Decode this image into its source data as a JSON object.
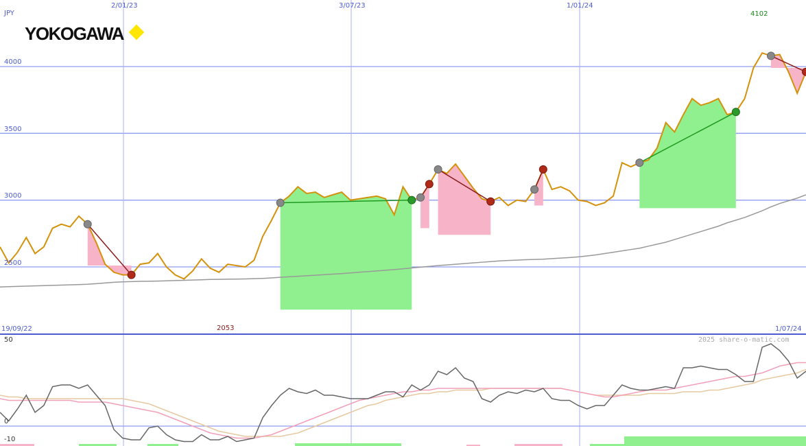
{
  "header": {
    "currency": "JPY",
    "logo_text": "YOKOGAWA",
    "logo_accent_color": "#ffe600"
  },
  "date_labels": {
    "top": [
      "2/01/23",
      "3/07/23",
      "1/01/24"
    ],
    "start": "19/09/22",
    "end": "1/07/24"
  },
  "annotations": {
    "high": "4102",
    "low": "2053"
  },
  "watermark": "2025 share-o-matic.com",
  "chart_data": [
    {
      "type": "line",
      "x_range": [
        "19/09/22",
        "1/07/24"
      ],
      "ylim": [
        2000,
        4200
      ],
      "y_ticks": [
        2500,
        3000,
        3500,
        4000
      ],
      "grid": true,
      "series": [
        {
          "name": "",
          "color": "#d4920b",
          "values": [
            2650,
            2530,
            2610,
            2720,
            2600,
            2650,
            2790,
            2820,
            2800,
            2880,
            2820,
            2680,
            2520,
            2460,
            2440,
            2440,
            2520,
            2530,
            2600,
            2500,
            2440,
            2410,
            2470,
            2560,
            2490,
            2460,
            2520,
            2510,
            2500,
            2550,
            2730,
            2850,
            2980,
            3030,
            3100,
            3050,
            3060,
            3020,
            3040,
            3060,
            3000,
            3010,
            3020,
            3030,
            3010,
            2890,
            3100,
            3000,
            3020,
            3120,
            3230,
            3200,
            3270,
            3180,
            3090,
            3010,
            2990,
            3020,
            2960,
            3000,
            2990,
            3080,
            3230,
            3080,
            3100,
            3070,
            3000,
            2990,
            2960,
            2980,
            3030,
            3280,
            3250,
            3280,
            3300,
            3390,
            3580,
            3510,
            3640,
            3760,
            3710,
            3730,
            3760,
            3640,
            3660,
            3760,
            3990,
            4102,
            4080,
            4090,
            3960,
            3800,
            3960
          ]
        },
        {
          "name": "",
          "color": "#999999",
          "values": [
            2350,
            2352,
            2354,
            2356,
            2358,
            2360,
            2362,
            2364,
            2366,
            2368,
            2370,
            2375,
            2380,
            2385,
            2388,
            2390,
            2392,
            2393,
            2394,
            2396,
            2398,
            2400,
            2402,
            2404,
            2406,
            2407,
            2408,
            2409,
            2410,
            2412,
            2414,
            2418,
            2422,
            2426,
            2430,
            2434,
            2438,
            2442,
            2446,
            2450,
            2455,
            2460,
            2465,
            2470,
            2475,
            2480,
            2486,
            2492,
            2498,
            2504,
            2510,
            2515,
            2520,
            2525,
            2530,
            2535,
            2540,
            2545,
            2548,
            2551,
            2554,
            2556,
            2558,
            2562,
            2566,
            2570,
            2575,
            2582,
            2590,
            2600,
            2610,
            2620,
            2630,
            2640,
            2655,
            2670,
            2685,
            2705,
            2725,
            2745,
            2765,
            2785,
            2805,
            2830,
            2850,
            2870,
            2895,
            2920,
            2950,
            2975,
            2995,
            3015,
            3040
          ]
        }
      ],
      "trades": [
        {
          "entry_index": 10,
          "exit_index": 15,
          "entry_value": 2510,
          "exit_value": 2410,
          "result": "loss"
        },
        {
          "entry_index": 32,
          "exit_index": 47,
          "entry_value": 2180,
          "exit_value": 2600,
          "result": "gain"
        },
        {
          "entry_index": 48,
          "exit_index": 49,
          "entry_value": 2790,
          "exit_value": 2690,
          "result": "loss"
        },
        {
          "entry_index": 50,
          "exit_index": 56,
          "entry_value": 2740,
          "exit_value": 2670,
          "result": "loss"
        },
        {
          "entry_index": 61,
          "exit_index": 62,
          "entry_value": 2960,
          "exit_value": 2800,
          "result": "loss"
        },
        {
          "entry_index": 73,
          "exit_index": 84,
          "entry_value": 2940,
          "exit_value": 3430,
          "result": "gain"
        },
        {
          "entry_index": 88,
          "exit_index": 92,
          "entry_value": 3990,
          "exit_value": 3780,
          "result": "loss"
        }
      ]
    },
    {
      "type": "line",
      "ylim": [
        -10,
        50
      ],
      "y_ticks": [
        -10,
        0,
        50
      ],
      "series": [
        {
          "name": "",
          "color": "#666666",
          "values": [
            8,
            3,
            10,
            18,
            8,
            12,
            23,
            24,
            24,
            22,
            24,
            18,
            12,
            -2,
            -7,
            -8,
            -8,
            -1,
            0,
            -5,
            -8,
            -9,
            -9,
            -5,
            -8,
            -8,
            -6,
            -9,
            -8,
            -7,
            5,
            12,
            18,
            22,
            20,
            19,
            21,
            18,
            18,
            17,
            16,
            16,
            16,
            18,
            20,
            20,
            17,
            24,
            21,
            24,
            32,
            30,
            34,
            28,
            26,
            16,
            14,
            18,
            20,
            19,
            21,
            20,
            22,
            16,
            15,
            15,
            12,
            10,
            12,
            12,
            18,
            24,
            22,
            21,
            21,
            22,
            23,
            22,
            34,
            34,
            35,
            34,
            33,
            33,
            30,
            26,
            26,
            46,
            48,
            44,
            38,
            28,
            32
          ]
        },
        {
          "name": "",
          "color": "#f2a0b8",
          "values": [
            16,
            15,
            15,
            15,
            15,
            15,
            15,
            15,
            15,
            14,
            14,
            14,
            14,
            13,
            12,
            11,
            10,
            9,
            8,
            6,
            4,
            2,
            0,
            -2,
            -4,
            -5,
            -6,
            -7,
            -7,
            -7,
            -6,
            -5,
            -3,
            -1,
            1,
            3,
            5,
            7,
            9,
            11,
            13,
            15,
            16,
            17,
            18,
            19,
            20,
            20,
            21,
            21,
            22,
            22,
            22,
            22,
            22,
            22,
            22,
            22,
            22,
            22,
            22,
            22,
            22,
            22,
            22,
            21,
            20,
            19,
            18,
            17,
            17,
            18,
            19,
            20,
            21,
            21,
            21,
            22,
            23,
            24,
            25,
            26,
            27,
            28,
            29,
            29,
            30,
            31,
            33,
            35,
            36,
            37,
            37
          ]
        },
        {
          "name": "",
          "color": "#e6c9a0",
          "values": [
            18,
            17,
            17,
            16,
            16,
            16,
            16,
            16,
            16,
            16,
            16,
            16,
            16,
            16,
            16,
            15,
            14,
            13,
            11,
            9,
            7,
            5,
            3,
            1,
            -1,
            -3,
            -4,
            -5,
            -6,
            -6,
            -6,
            -6,
            -6,
            -5,
            -4,
            -2,
            0,
            2,
            4,
            6,
            8,
            10,
            12,
            13,
            15,
            16,
            17,
            18,
            19,
            19,
            20,
            20,
            21,
            21,
            21,
            21,
            22,
            22,
            22,
            22,
            22,
            22,
            22,
            22,
            22,
            21,
            20,
            19,
            18,
            18,
            18,
            18,
            18,
            18,
            19,
            19,
            19,
            19,
            20,
            20,
            20,
            21,
            21,
            22,
            23,
            24,
            25,
            27,
            28,
            29,
            30,
            31,
            33
          ]
        }
      ]
    }
  ]
}
